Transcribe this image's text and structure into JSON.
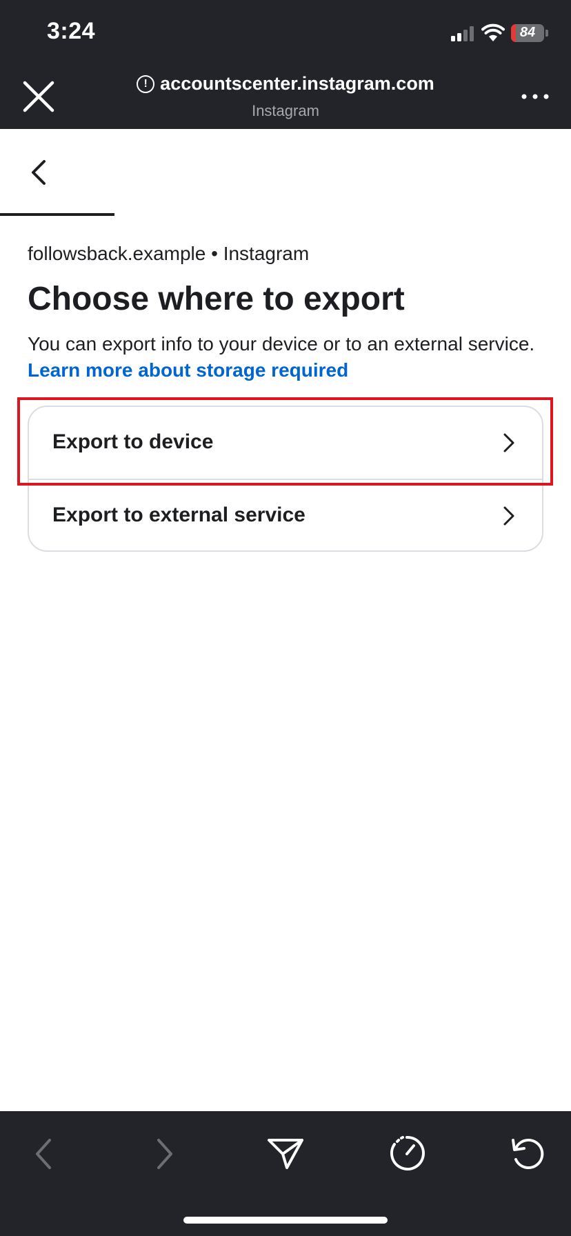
{
  "status_bar": {
    "time": "3:24",
    "battery_level": "84",
    "battery_fraction": 0.15,
    "icons": [
      "cellular-signal-icon",
      "wifi-icon",
      "battery-charging-icon"
    ]
  },
  "browser": {
    "url": "accountscenter.instagram.com",
    "site_name": "Instagram",
    "close_icon": "close-icon",
    "info_icon": "info-icon",
    "more_icon": "more-options-icon"
  },
  "content": {
    "account_label": "followsback.example • Instagram",
    "title": "Choose where to export",
    "description": "You can export info to your device or to an external service.",
    "learn_more_link": "Learn more about storage required",
    "options": [
      {
        "label": "Export to device"
      },
      {
        "label": "Export to external service"
      }
    ]
  },
  "toolbar": {
    "icons": [
      "back-arrow-icon",
      "forward-arrow-icon",
      "share-icon",
      "speed-icon",
      "reload-icon"
    ]
  },
  "colors": {
    "bar_background": "#22242a",
    "link": "#0064d1",
    "highlight": "#e0141e",
    "battery_low": "#e53935"
  }
}
